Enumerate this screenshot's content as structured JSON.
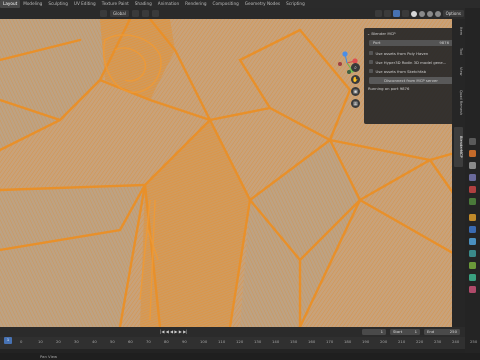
{
  "workspaces": [
    "Layout",
    "Modeling",
    "Sculpting",
    "UV Editing",
    "Texture Paint",
    "Shading",
    "Animation",
    "Rendering",
    "Compositing",
    "Geometry Nodes",
    "Scripting"
  ],
  "viewport": {
    "shading_mode": "Global",
    "options_label": "Options",
    "object_label": "Object"
  },
  "mcp_panel": {
    "title": "Blender MCP",
    "port_label": "Port",
    "port_value": "9876",
    "checkboxes": [
      "Use assets from Poly Haven",
      "Use Hyper3D Rodin 3D model gene...",
      "Use assets from Sketchfab"
    ],
    "disconnect_button": "Disconnect from MCP server",
    "status": "Running on port 9876"
  },
  "sidebar_tabs": [
    "Item",
    "Tool",
    "View",
    "Quad Remesh",
    "BlenderMCP"
  ],
  "timeline": {
    "frame_current": "1",
    "start_label": "Start",
    "start_value": "1",
    "end_label": "End",
    "end_value": "250",
    "ticks": [
      "0",
      "10",
      "20",
      "30",
      "40",
      "50",
      "60",
      "70",
      "80",
      "90",
      "100",
      "110",
      "120",
      "130",
      "140",
      "150",
      "160",
      "170",
      "180",
      "190",
      "200",
      "210",
      "220",
      "230",
      "240",
      "250"
    ],
    "playhead_label": "1"
  },
  "status": {
    "left": "Pan View"
  },
  "colors": {
    "wire": "#e8902a",
    "accent": "#4772b3"
  }
}
